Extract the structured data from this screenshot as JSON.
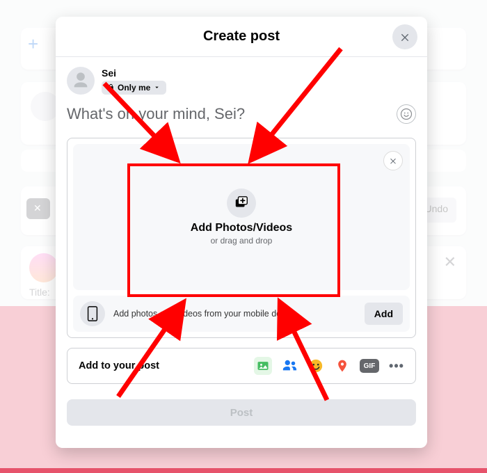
{
  "bg": {
    "undo": "Undo",
    "titleLabel": "Title:"
  },
  "modal": {
    "title": "Create post",
    "user": {
      "name": "Sei",
      "audience": "Only me"
    },
    "placeholder": "What's on your mind, Sei?",
    "upload": {
      "title": "Add Photos/Videos",
      "subtitle": "or drag and drop",
      "mobileText": "Add photos and videos from your mobile device.",
      "addLabel": "Add"
    },
    "addTo": {
      "label": "Add to your post",
      "gif": "GIF"
    },
    "post": "Post"
  }
}
